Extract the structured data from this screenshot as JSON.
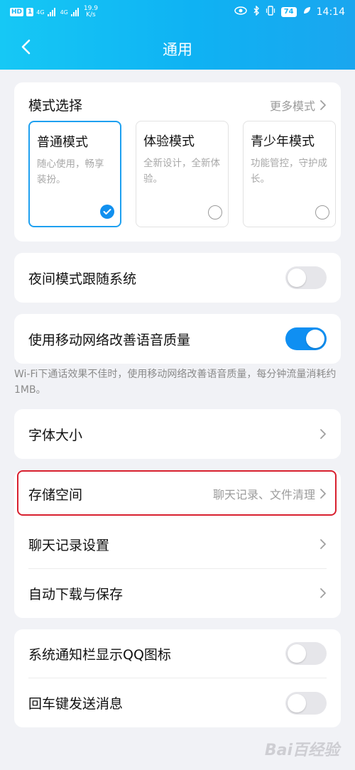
{
  "status_bar": {
    "hd": "HD",
    "sim": "1",
    "network1": "4G",
    "network2": "4G",
    "speed_value": "19.9",
    "speed_unit": "K/s",
    "battery": "74",
    "time": "14:14"
  },
  "header": {
    "title": "通用"
  },
  "mode_section": {
    "title": "模式选择",
    "more_label": "更多模式",
    "options": [
      {
        "name": "普通模式",
        "desc": "随心使用，畅享装扮。",
        "selected": true
      },
      {
        "name": "体验模式",
        "desc": "全新设计，全新体验。",
        "selected": false
      },
      {
        "name": "青少年模式",
        "desc": "功能管控，守护成长。",
        "selected": false
      }
    ]
  },
  "settings": {
    "night_mode": {
      "label": "夜间模式跟随系统",
      "on": false
    },
    "mobile_voice": {
      "label": "使用移动网络改善语音质量",
      "on": true
    },
    "mobile_voice_note": "Wi-Fi下通话效果不佳时，使用移动网络改善语音质量，每分钟流量消耗约1MB。",
    "font_size": {
      "label": "字体大小"
    },
    "storage": {
      "label": "存储空间",
      "sub": "聊天记录、文件清理"
    },
    "chat_history": {
      "label": "聊天记录设置"
    },
    "auto_download": {
      "label": "自动下载与保存"
    },
    "notify_icon": {
      "label": "系统通知栏显示QQ图标",
      "on": false
    },
    "enter_send": {
      "label": "回车键发送消息",
      "on": false
    }
  },
  "colors": {
    "accent": "#0f8ff2",
    "header": "#16b6f4",
    "highlight": "#d8202f"
  },
  "watermark": "Bai百经验"
}
